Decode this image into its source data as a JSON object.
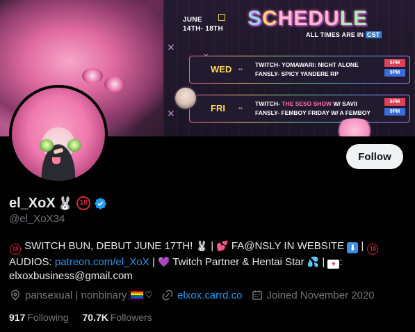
{
  "banner": {
    "schedule_date_line1": "JUNE",
    "schedule_date_line2": "14TH- 18TH",
    "schedule_title_a": "S",
    "schedule_title_b": "C",
    "schedule_title_c": "HEDU",
    "schedule_title_d": "LE",
    "schedule_timezone_prefix": "ALL TIMES ARE IN ",
    "schedule_timezone": "CST",
    "days": [
      {
        "day": "WED",
        "line1": "TWITCH- YOMAWARI: NIGHT ALONE",
        "line2": "FANSLY- SPICY YANDERE RP",
        "time1": "5PM",
        "time2": "9PM"
      },
      {
        "day": "FRI",
        "line1_prefix": "TWITCH- ",
        "line1_highlight": "THE SESO SHOW",
        "line1_suffix": " W/ SAVII",
        "line2": "FANSLY- FEMBOY FRIDAY W/ A FEMBOY",
        "time1": "5PM",
        "time2": "9PM"
      }
    ]
  },
  "profile": {
    "display_name": "el_XoX",
    "age_badge": "18",
    "handle": "@el_XoX34",
    "follow_label": "Follow"
  },
  "bio": {
    "line1_a": " SWITCH BUN, DEBUT JUNE 17TH! ",
    "line1_b": " | ",
    "line1_c": " FA@NSLY IN WEBSITE ",
    "line1_d": " | ",
    "line2_a": "AUDIOS: ",
    "line2_link": "patreon.com/el_XoX",
    "line2_b": " | ",
    "line2_c": " Twitch Partner & Hentai Star ",
    "line2_d": " | ",
    "line2_e": ":",
    "line3": "elxoxbusiness@gmail.com",
    "badge_18": "18"
  },
  "meta": {
    "location": "pansexual | nonbinary",
    "website": "elxox.carrd.co",
    "joined": "Joined November 2020"
  },
  "stats": {
    "following_count": "917",
    "following_label": "Following",
    "followers_count": "70.7K",
    "followers_label": "Followers"
  },
  "colors": {
    "accent_blue": "#1d9bf0",
    "text_primary": "#e7e9ea",
    "text_secondary": "#71767b",
    "background": "#000000",
    "follow_button_bg": "#eff3f4"
  },
  "icons": [
    "rabbit-emoji-icon",
    "18-plus-icon",
    "verified-badge-icon",
    "location-icon",
    "link-icon",
    "calendar-icon",
    "pride-flag-icon"
  ]
}
